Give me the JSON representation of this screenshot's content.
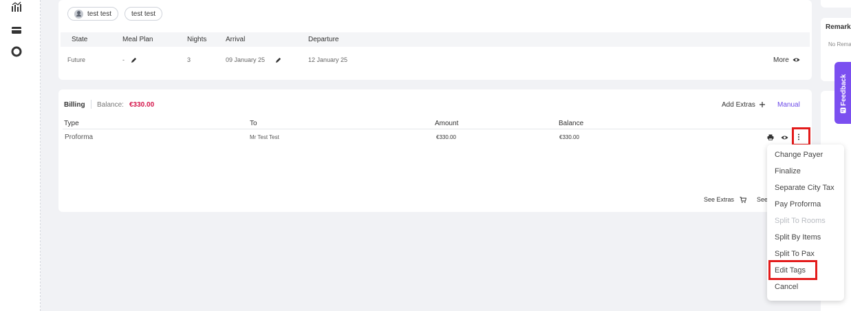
{
  "nav": {
    "icons": [
      "chart-icon",
      "card-icon",
      "settings-icon"
    ]
  },
  "guests": [
    {
      "name": "test test",
      "has_avatar": true
    },
    {
      "name": "test test",
      "has_avatar": false
    }
  ],
  "reservation": {
    "columns": [
      "State",
      "Meal Plan",
      "Nights",
      "Arrival",
      "Departure"
    ],
    "row": {
      "state": "Future",
      "meal_plan": "-",
      "nights": "3",
      "arrival": "09 January 25",
      "departure": "12 January 25"
    },
    "more_label": "More"
  },
  "billing": {
    "title": "Billing",
    "balance_label": "Balance:",
    "balance_value": "€330.00",
    "add_extras_label": "Add Extras",
    "manual_label": "Manual",
    "columns": [
      "Type",
      "To",
      "Amount",
      "Balance"
    ],
    "rows": [
      {
        "type": "Proforma",
        "to": "Mr Test Test",
        "amount": "€330.00",
        "balance": "€330.00"
      }
    ],
    "see_extras_label": "See Extras",
    "see_truncated_label": "See"
  },
  "context_menu": {
    "items": [
      {
        "label": "Change Payer",
        "disabled": false
      },
      {
        "label": "Finalize",
        "disabled": false
      },
      {
        "label": "Separate City Tax",
        "disabled": false
      },
      {
        "label": "Pay Proforma",
        "disabled": false
      },
      {
        "label": "Split To Rooms",
        "disabled": true
      },
      {
        "label": "Split By Items",
        "disabled": false
      },
      {
        "label": "Split To Pax",
        "disabled": false
      },
      {
        "label": "Edit Tags",
        "disabled": false
      },
      {
        "label": "Cancel",
        "disabled": false
      }
    ]
  },
  "side": {
    "remarks_title": "Remarks",
    "remarks_text": "No Remarks"
  },
  "feedback_label": "Feedback",
  "colors": {
    "accent": "#6b49e8",
    "balance": "#d4154a",
    "highlight": "#e31b1b",
    "feedback": "#7b4ff0"
  }
}
